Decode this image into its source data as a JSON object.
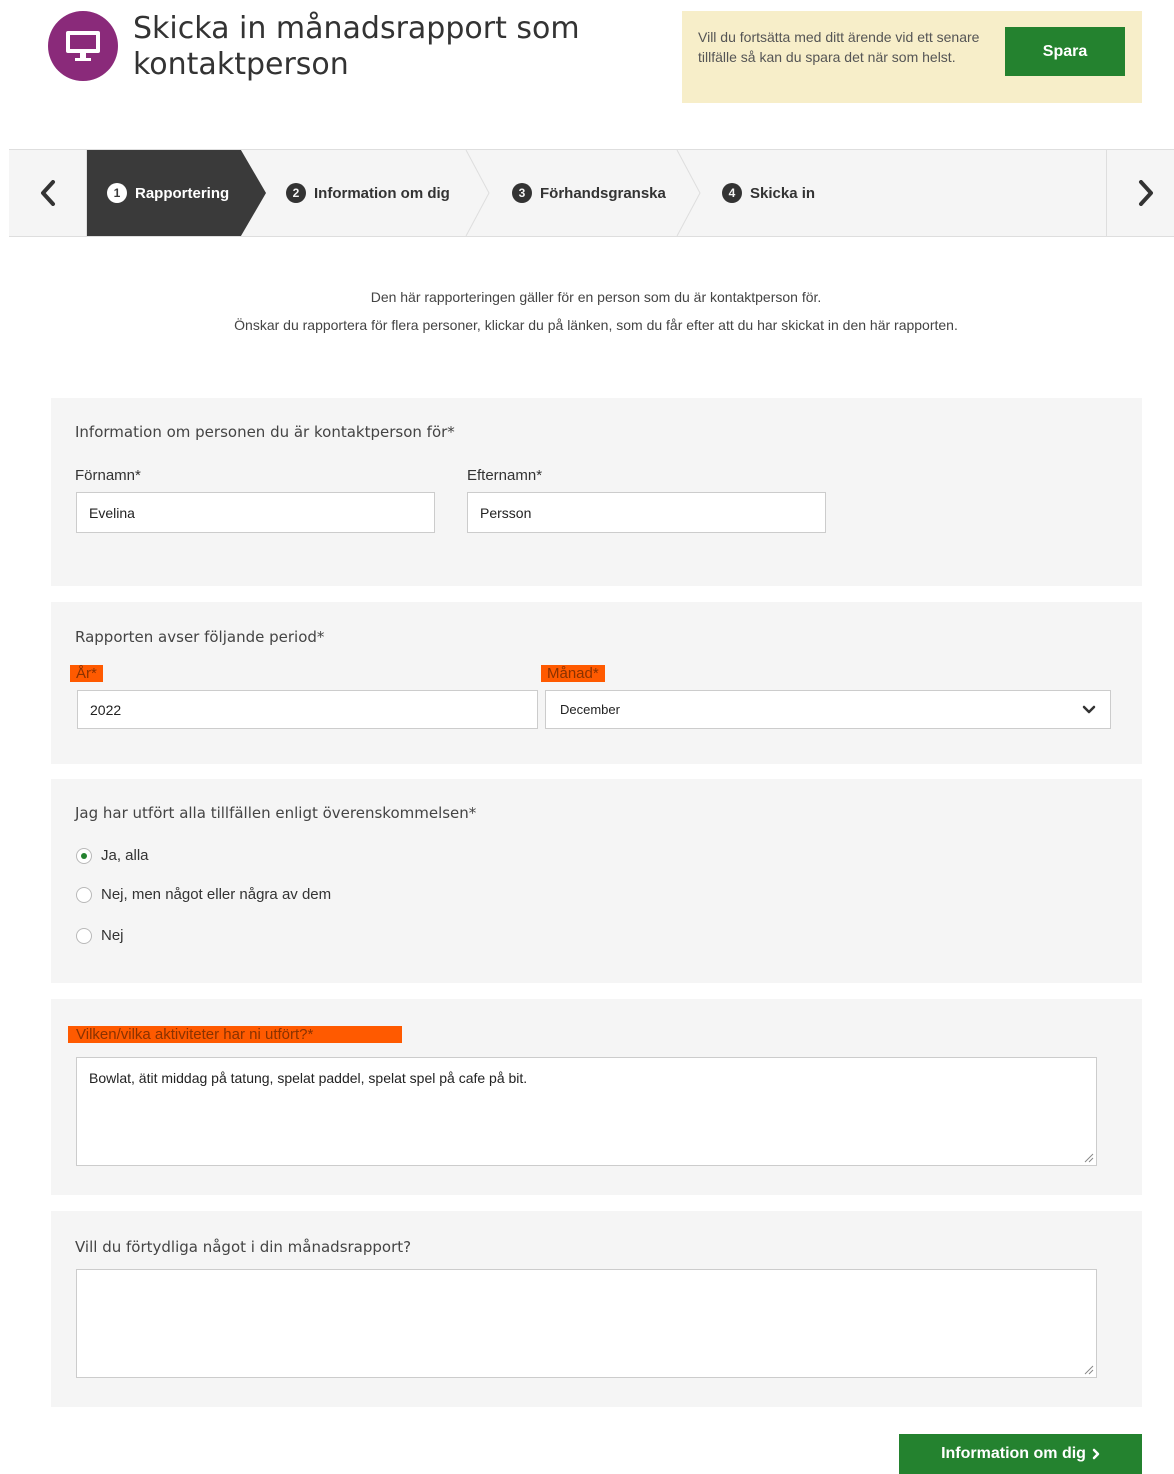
{
  "header": {
    "title": "Skicka in månadsrapport som kontaktperson",
    "save_text": "Vill du fortsätta med ditt ärende vid ett senare tillfälle så kan du spara det när som helst.",
    "save_label": "Spara"
  },
  "steps": [
    {
      "num": "1",
      "label": "Rapportering",
      "active": true
    },
    {
      "num": "2",
      "label": "Information om dig",
      "active": false
    },
    {
      "num": "3",
      "label": "Förhandsgranska",
      "active": false
    },
    {
      "num": "4",
      "label": "Skicka in",
      "active": false
    }
  ],
  "intro": {
    "line1": "Den här rapporteringen gäller för en person som du är kontaktperson för.",
    "line2": "Önskar du rapportera för flera personer, klickar du på länken, som du får efter att du har skickat in den här rapporten."
  },
  "person": {
    "title": "Information om personen du är kontaktperson för*",
    "firstname_label": "Förnamn*",
    "firstname_value": "Evelina",
    "lastname_label": "Efternamn*",
    "lastname_value": "Persson"
  },
  "period": {
    "title": "Rapporten avser följande period*",
    "year_label": "År*",
    "year_value": "2022",
    "month_label": "Månad*",
    "month_value": "December"
  },
  "sessions": {
    "title": "Jag har utfört alla tillfällen enligt överenskommelsen*",
    "options": [
      {
        "label": "Ja, alla",
        "checked": true
      },
      {
        "label": "Nej, men något eller några av dem",
        "checked": false
      },
      {
        "label": "Nej",
        "checked": false
      }
    ]
  },
  "activities": {
    "label": "Vilken/vilka aktiviteter har ni utfört?*",
    "value": "Bowlat, ätit middag på tatung, spelat paddel, spelat spel på cafe på bit."
  },
  "clarify": {
    "label": "Vill du förtydliga något i din månadsrapport?",
    "value": ""
  },
  "footer": {
    "next_label": "Information om dig"
  },
  "colors": {
    "primary_green": "#24822f",
    "brand_purple": "#8a2a7a",
    "highlight_orange": "#ff5a00",
    "notice_bg": "#f7eec9"
  }
}
